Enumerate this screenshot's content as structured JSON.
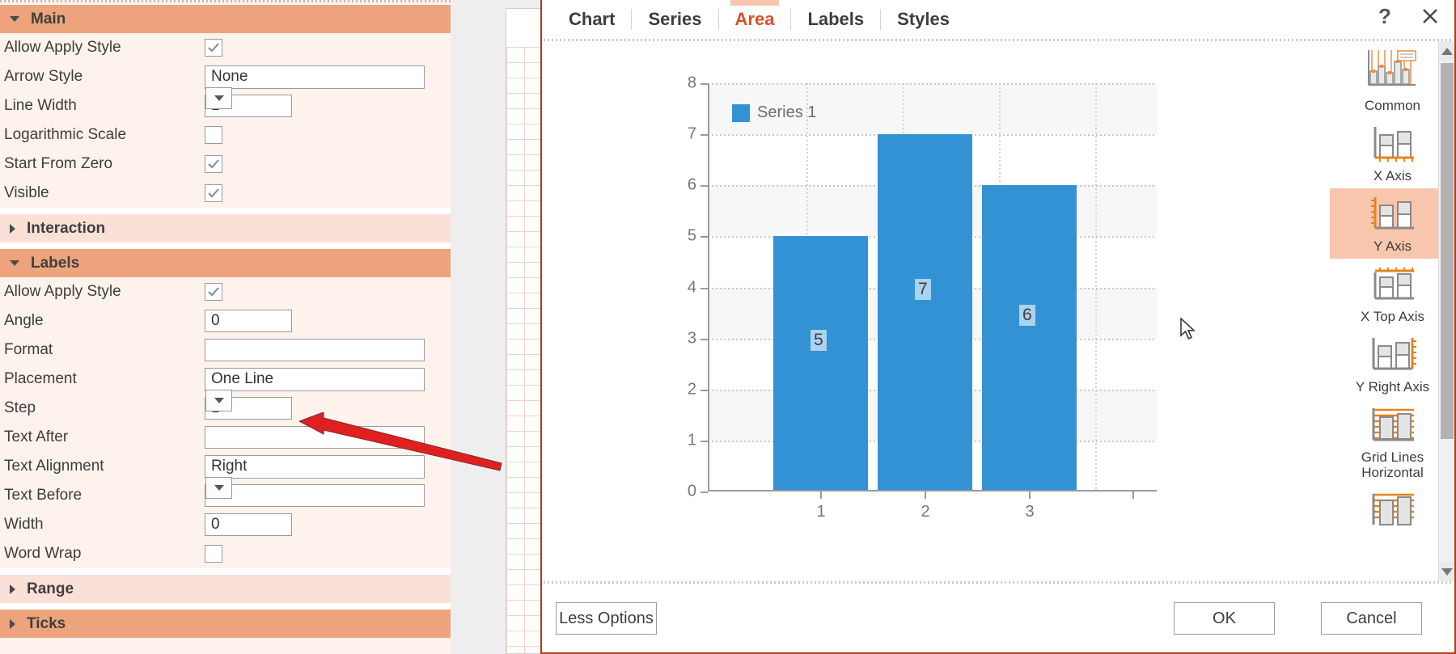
{
  "properties_panel": {
    "sections": [
      {
        "title": "Main",
        "state": "expanded",
        "rows": [
          {
            "label": "Allow Apply Style",
            "control": "checkbox",
            "value": "checked"
          },
          {
            "label": "Arrow Style",
            "control": "combo",
            "value": "None"
          },
          {
            "label": "Line Width",
            "control": "text-small",
            "value": "1"
          },
          {
            "label": "Logarithmic Scale",
            "control": "checkbox",
            "value": "unchecked"
          },
          {
            "label": "Start From Zero",
            "control": "checkbox",
            "value": "checked"
          },
          {
            "label": "Visible",
            "control": "checkbox",
            "value": "checked"
          }
        ]
      },
      {
        "title": "Interaction",
        "state": "collapsed",
        "rows": []
      },
      {
        "title": "Labels",
        "state": "expanded",
        "rows": [
          {
            "label": "Allow Apply Style",
            "control": "checkbox",
            "value": "checked"
          },
          {
            "label": "Angle",
            "control": "text-small",
            "value": "0"
          },
          {
            "label": "Format",
            "control": "text-wide",
            "value": ""
          },
          {
            "label": "Placement",
            "control": "combo",
            "value": "One Line"
          },
          {
            "label": "Step",
            "control": "text-small",
            "value": "1"
          },
          {
            "label": "Text After",
            "control": "text-wide",
            "value": ""
          },
          {
            "label": "Text Alignment",
            "control": "combo",
            "value": "Right"
          },
          {
            "label": "Text Before",
            "control": "text-wide",
            "value": ""
          },
          {
            "label": "Width",
            "control": "text-small",
            "value": "0"
          },
          {
            "label": "Word Wrap",
            "control": "checkbox",
            "value": "unchecked"
          }
        ]
      },
      {
        "title": "Range",
        "state": "collapsed",
        "rows": []
      },
      {
        "title": "Ticks",
        "state": "collapsed",
        "rows": []
      }
    ]
  },
  "dialog": {
    "tabs": [
      {
        "label": "Chart",
        "active": false
      },
      {
        "label": "Series",
        "active": false
      },
      {
        "label": "Area",
        "active": true
      },
      {
        "label": "Labels",
        "active": false
      },
      {
        "label": "Styles",
        "active": false
      }
    ],
    "help_icon": "help-question-icon",
    "close_icon": "close-x-icon",
    "footer": {
      "less_options": "Less Options",
      "ok": "OK",
      "cancel": "Cancel"
    },
    "gallery": {
      "items": [
        {
          "label": "Common",
          "icon": "chart-common-icon",
          "selected": false
        },
        {
          "label": "X Axis",
          "icon": "chart-x-axis-icon",
          "selected": false
        },
        {
          "label": "Y Axis",
          "icon": "chart-y-axis-icon",
          "selected": true
        },
        {
          "label": "X Top Axis",
          "icon": "chart-x-top-axis-icon",
          "selected": false
        },
        {
          "label": "Y Right Axis",
          "icon": "chart-y-right-axis-icon",
          "selected": false
        },
        {
          "label": "Grid Lines Horizontal",
          "icon": "chart-grid-lines-horizontal-icon",
          "selected": false
        },
        {
          "label": "",
          "icon": "chart-grid-lines-icon",
          "selected": false
        }
      ],
      "scrollbar_up": "scroll-up-arrow-icon",
      "scrollbar_down": "scroll-down-arrow-icon"
    }
  },
  "annotation": {
    "arrow_color": "#e02020",
    "points_to": "Step"
  },
  "colors": {
    "accent_orange": "#eda47c",
    "section_collapsed": "#fbe0d8",
    "panel_bg": "#fdf2ec",
    "tab_active": "#d8512a",
    "dialog_border": "#b5391a",
    "bar_blue": "#3392d4",
    "label_highlight": "#a9d3ef"
  },
  "chart_data": {
    "type": "bar",
    "title": "",
    "xlabel": "",
    "ylabel": "",
    "categories": [
      "1",
      "2",
      "3"
    ],
    "series": [
      {
        "name": "Series 1",
        "values": [
          5,
          7,
          6
        ],
        "color": "#3392d4"
      }
    ],
    "data_labels": [
      "5",
      "7",
      "6"
    ],
    "ylim": [
      0,
      8
    ],
    "yticks": [
      "0",
      "1",
      "2",
      "3",
      "4",
      "5",
      "6",
      "7",
      "8"
    ],
    "xticks": [
      "1",
      "2",
      "3"
    ],
    "grid": "horizontal-dotted-and-vertical-dotted",
    "legend": {
      "position": "top-left",
      "entries": [
        "Series 1"
      ]
    }
  }
}
